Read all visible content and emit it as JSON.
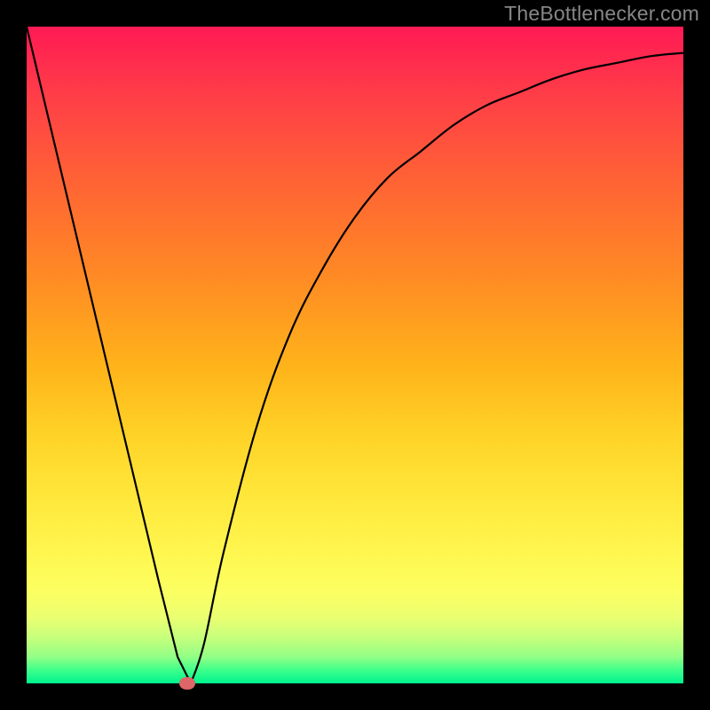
{
  "watermark": "TheBottlenecker.com",
  "chart_data": {
    "type": "line",
    "title": "",
    "xlabel": "",
    "ylabel": "",
    "xlim": [
      0,
      100
    ],
    "ylim": [
      0,
      100
    ],
    "series": [
      {
        "name": "curve",
        "x": [
          0,
          5,
          10,
          15,
          20,
          23,
          25,
          27,
          30,
          35,
          40,
          45,
          50,
          55,
          60,
          65,
          70,
          75,
          80,
          85,
          90,
          95,
          100
        ],
        "values": [
          100,
          79,
          58,
          37,
          16,
          4,
          0,
          6,
          20,
          39,
          53,
          63,
          71,
          77,
          81,
          85,
          88,
          90,
          92,
          93.5,
          94.5,
          95.5,
          96
        ]
      }
    ],
    "marker": {
      "x": 24.5,
      "y": 0
    },
    "colors": {
      "curve": "#000000",
      "marker": "#de6568"
    }
  }
}
